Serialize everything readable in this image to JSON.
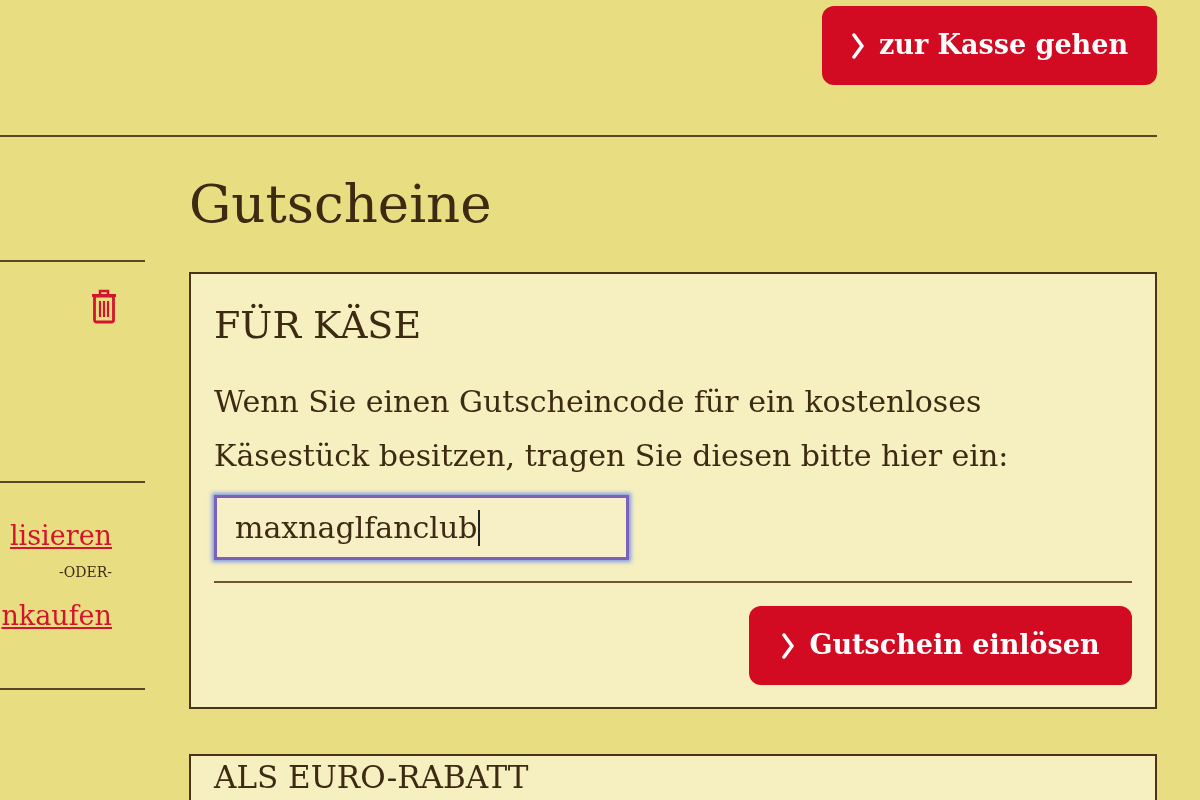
{
  "checkout_button": {
    "label": "zur Kasse gehen"
  },
  "cart_sidebar": {
    "update_link": "lisieren",
    "separator": "-ODER-",
    "continue_link": "nkaufen"
  },
  "vouchers": {
    "title": "Gutscheine",
    "cards": [
      {
        "title": "FÜR KÄSE",
        "text": "Wenn Sie einen Gutscheincode für ein kostenloses Käsestück besitzen, tragen Sie diesen bitte hier ein:",
        "input": {
          "value": "maxnaglfanclub",
          "focused": true
        },
        "button": "Gutschein einlösen"
      },
      {
        "title": "ALS EURO-RABATT"
      }
    ]
  }
}
